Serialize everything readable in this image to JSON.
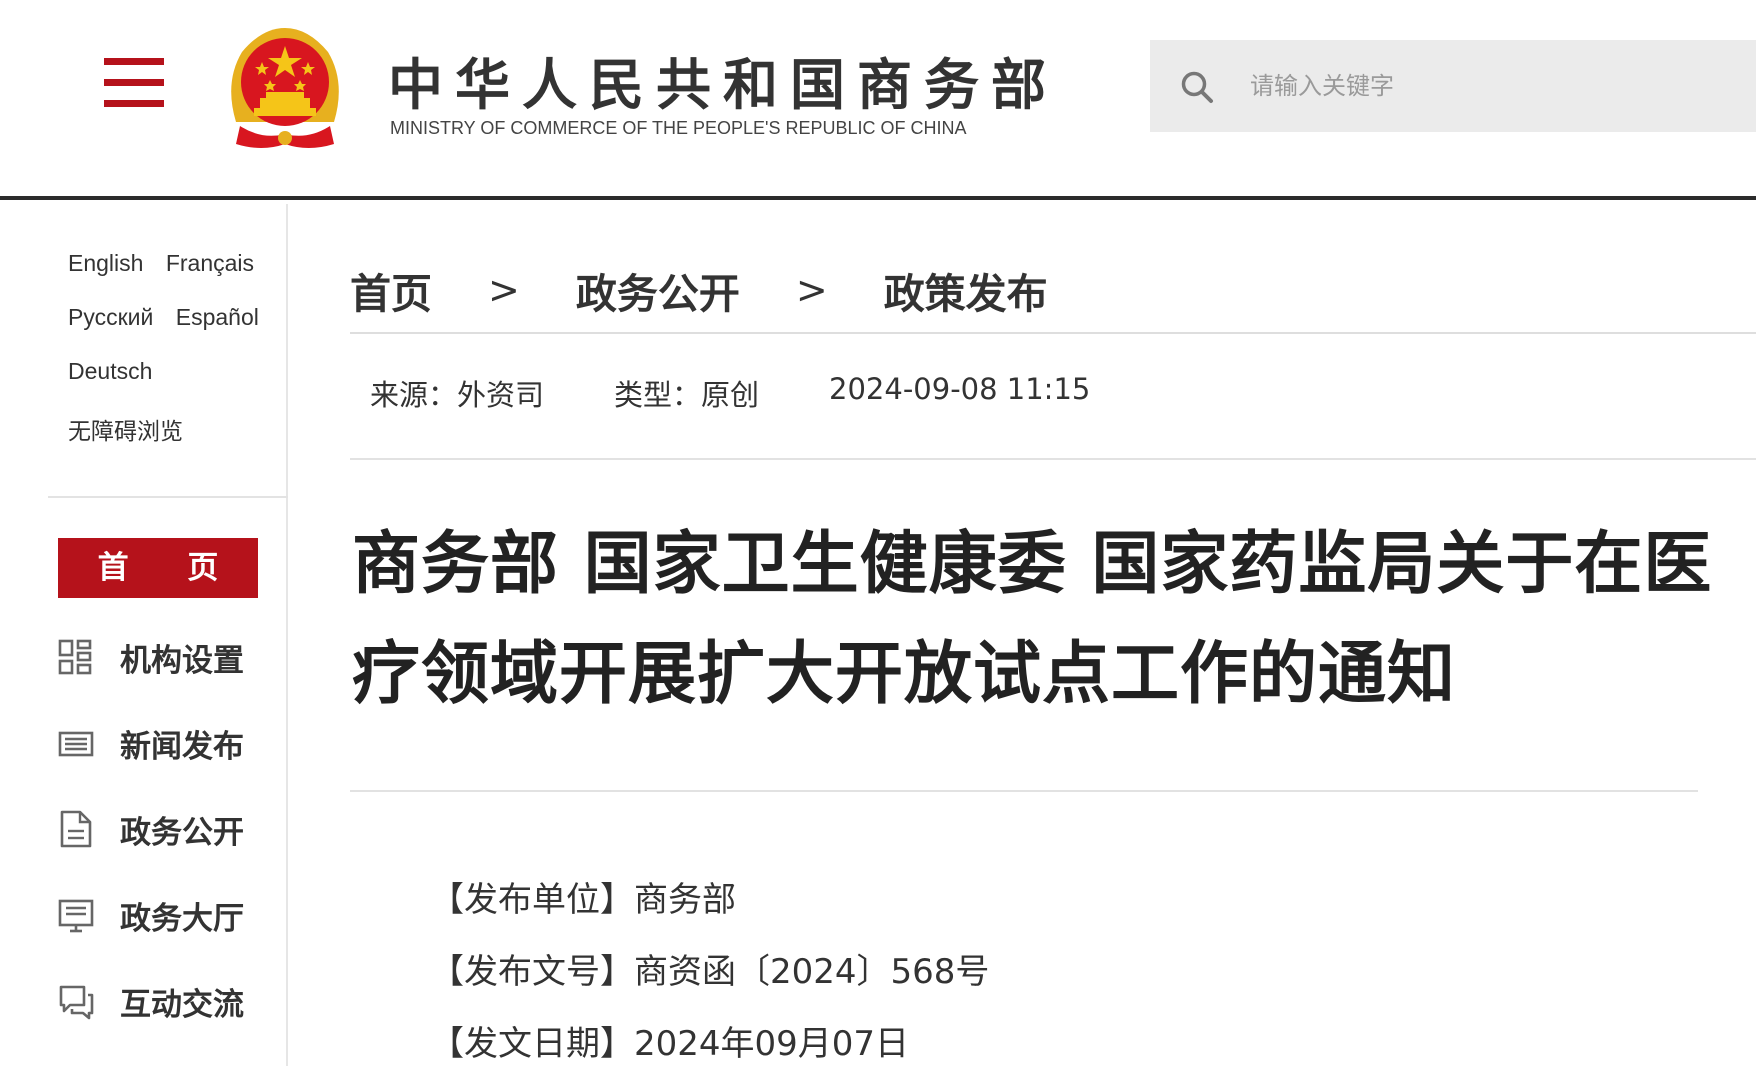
{
  "header": {
    "logo_cn": "中华人民共和国商务部",
    "logo_en": "MINISTRY OF COMMERCE OF THE PEOPLE'S REPUBLIC OF CHINA",
    "search_placeholder": "请输入关键字",
    "accent_color": "#b5121b"
  },
  "sidebar": {
    "languages": [
      [
        "English",
        "Français"
      ],
      [
        "Русский",
        "Español"
      ],
      [
        "Deutsch"
      ],
      [
        "无障碍浏览"
      ]
    ],
    "home_label": "首 页",
    "items": [
      {
        "label": "机构设置",
        "icon": "grid-icon"
      },
      {
        "label": "新闻发布",
        "icon": "newspaper-icon"
      },
      {
        "label": "政务公开",
        "icon": "document-icon"
      },
      {
        "label": "政务大厅",
        "icon": "monitor-icon"
      },
      {
        "label": "互动交流",
        "icon": "chat-icon"
      }
    ]
  },
  "breadcrumb": {
    "items": [
      "首页",
      "政务公开",
      "政策发布"
    ],
    "separator": ">"
  },
  "meta": {
    "source": "来源：外资司",
    "type": "类型：原创",
    "datetime": "2024-09-08 11:15"
  },
  "article": {
    "title": "商务部 国家卫生健康委 国家药监局关于在医疗领域开展扩大开放试点工作的通知",
    "info": [
      {
        "label": "【发布单位】",
        "value": "商务部"
      },
      {
        "label": "【发布文号】",
        "value": "商资函〔2024〕568号"
      },
      {
        "label": "【发文日期】",
        "value": "2024年09月07日"
      }
    ]
  }
}
